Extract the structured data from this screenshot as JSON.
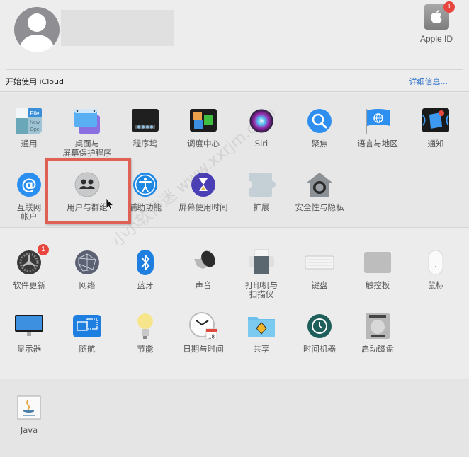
{
  "account": {
    "avatar": "user-silhouette-icon",
    "apple_id": {
      "label": "Apple ID",
      "icon": "apple-logo-icon",
      "badge": "1"
    }
  },
  "icloud": {
    "prompt": "开始使用 iCloud",
    "details_link": "详细信息..."
  },
  "sections": {
    "personal": [
      {
        "id": "general",
        "label": "通用",
        "icon": "general-icon"
      },
      {
        "id": "desktop",
        "label": "桌面与\n屏幕保护程序",
        "icon": "desktop-screensaver-icon"
      },
      {
        "id": "dock",
        "label": "程序坞",
        "icon": "dock-icon"
      },
      {
        "id": "mission-control",
        "label": "调度中心",
        "icon": "mission-control-icon"
      },
      {
        "id": "siri",
        "label": "Siri",
        "icon": "siri-icon"
      },
      {
        "id": "spotlight",
        "label": "聚焦",
        "icon": "spotlight-icon"
      },
      {
        "id": "language",
        "label": "语言与地区",
        "icon": "language-region-icon"
      },
      {
        "id": "notifications",
        "label": "通知",
        "icon": "notifications-icon"
      },
      {
        "id": "internet-accounts",
        "label": "互联网\n帐户",
        "icon": "internet-accounts-icon"
      },
      {
        "id": "users-groups",
        "label": "用户与群组",
        "icon": "users-groups-icon"
      },
      {
        "id": "accessibility",
        "label": "辅助功能",
        "icon": "accessibility-icon"
      },
      {
        "id": "screen-time",
        "label": "屏幕使用时间",
        "icon": "screen-time-icon"
      },
      {
        "id": "extensions",
        "label": "扩展",
        "icon": "extensions-icon"
      },
      {
        "id": "security",
        "label": "安全性与隐私",
        "icon": "security-privacy-icon"
      }
    ],
    "hardware": [
      {
        "id": "software-update",
        "label": "软件更新",
        "icon": "software-update-icon",
        "badge": "1"
      },
      {
        "id": "network",
        "label": "网络",
        "icon": "network-icon"
      },
      {
        "id": "bluetooth",
        "label": "蓝牙",
        "icon": "bluetooth-icon"
      },
      {
        "id": "sound",
        "label": "声音",
        "icon": "sound-icon"
      },
      {
        "id": "printers",
        "label": "打印机与\n扫描仪",
        "icon": "printer-icon"
      },
      {
        "id": "keyboard",
        "label": "键盘",
        "icon": "keyboard-icon"
      },
      {
        "id": "trackpad",
        "label": "触控板",
        "icon": "trackpad-icon"
      },
      {
        "id": "mouse",
        "label": "鼠标",
        "icon": "mouse-icon"
      },
      {
        "id": "displays",
        "label": "显示器",
        "icon": "display-icon"
      },
      {
        "id": "sidecar",
        "label": "随航",
        "icon": "sidecar-icon"
      },
      {
        "id": "energy",
        "label": "节能",
        "icon": "energy-saver-icon"
      },
      {
        "id": "date-time",
        "label": "日期与时间",
        "icon": "date-time-icon",
        "calendar_day": "18",
        "calendar_month": "JUL"
      },
      {
        "id": "sharing",
        "label": "共享",
        "icon": "sharing-icon"
      },
      {
        "id": "time-machine",
        "label": "时间机器",
        "icon": "time-machine-icon"
      },
      {
        "id": "startup-disk",
        "label": "启动磁盘",
        "icon": "startup-disk-icon"
      }
    ],
    "other": [
      {
        "id": "java",
        "label": "Java",
        "icon": "java-icon"
      }
    ]
  },
  "annotation": {
    "highlighted": "users-groups"
  },
  "watermark": "小小软件迷 www.xxrjm.com",
  "colors": {
    "link": "#2a6fc9",
    "badge": "#e8463e",
    "highlight_box": "#e06055"
  }
}
